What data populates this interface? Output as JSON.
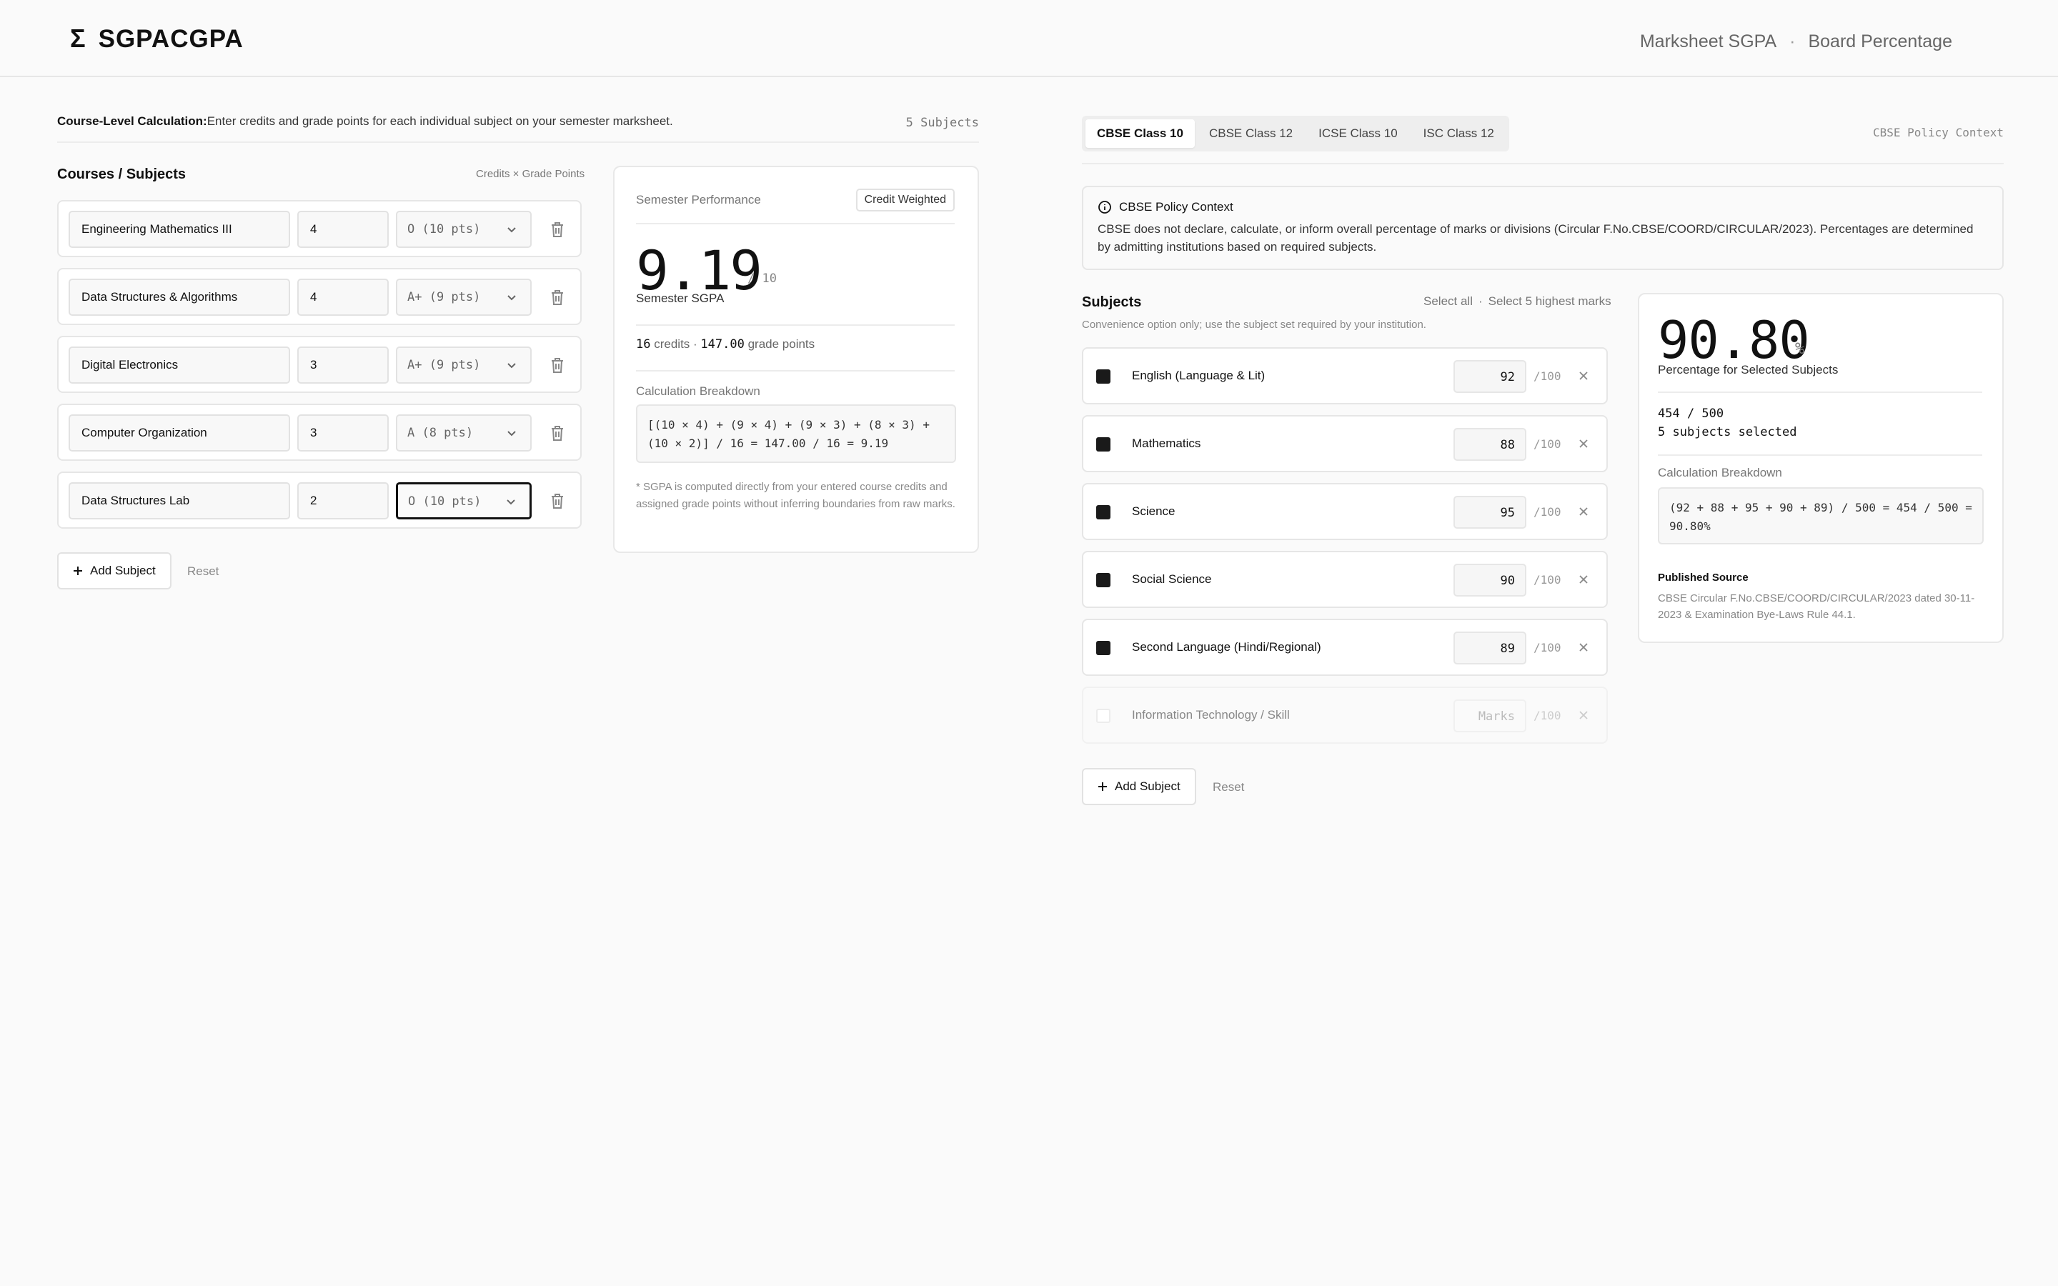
{
  "header": {
    "brand_symbol": "Σ",
    "brand_name": "SGPACGPA",
    "nav": [
      "Marksheet SGPA",
      "Board Percentage"
    ],
    "nav_separator": "·"
  },
  "left": {
    "intro_bold": "Course-Level Calculation:",
    "intro_text": "Enter credits and grade points for each individual subject on your semester marksheet.",
    "subject_count": "5 Subjects",
    "courses_title": "Courses / Subjects",
    "courses_hint": "Credits × Grade Points",
    "courses": [
      {
        "name": "Engineering Mathematics III",
        "credits": "4",
        "grade": "O (10 pts)"
      },
      {
        "name": "Data Structures & Algorithms",
        "credits": "4",
        "grade": "A+ (9 pts)"
      },
      {
        "name": "Digital Electronics",
        "credits": "3",
        "grade": "A+ (9 pts)"
      },
      {
        "name": "Computer Organization",
        "credits": "3",
        "grade": "A (8 pts)"
      },
      {
        "name": "Data Structures Lab",
        "credits": "2",
        "grade": "O (10 pts)"
      }
    ],
    "add_label": "Add Subject",
    "reset_label": "Reset"
  },
  "performance": {
    "label": "Semester Performance",
    "badge": "Credit Weighted",
    "sgpa": "9.19",
    "out_of": "/ 10",
    "sub": "Semester SGPA",
    "credits_value": "16",
    "credits_label": "credits ·",
    "points_value": "147.00",
    "points_label": "grade points",
    "breakdown_label": "Calculation Breakdown",
    "breakdown": "[(10 × 4) + (9 × 4) + (9 × 3) + (8 × 3) + (10 × 2)] / 16 = 147.00 / 16 = 9.19",
    "note": "* SGPA is computed directly from your entered course credits and assigned grade points without inferring boundaries from raw marks."
  },
  "right": {
    "tabs": [
      "CBSE Class 10",
      "CBSE Class 12",
      "ICSE Class 10",
      "ISC Class 12"
    ],
    "policy_link": "CBSE Policy Context",
    "policy_title": "CBSE Policy Context",
    "policy_body": "CBSE does not declare, calculate, or inform overall percentage of marks or divisions (Circular F.No.CBSE/COORD/CIRCULAR/2023). Percentages are determined by admitting institutions based on required subjects.",
    "subjects_title": "Subjects",
    "select_all": "Select all",
    "action_sep": "·",
    "select_top": "Select 5 highest marks",
    "subjects_note": "Convenience option only; use the subject set required by your institution.",
    "subjects": [
      {
        "name": "English (Language & Lit)",
        "marks": "92",
        "out_of": "/100"
      },
      {
        "name": "Mathematics",
        "marks": "88",
        "out_of": "/100"
      },
      {
        "name": "Science",
        "marks": "95",
        "out_of": "/100"
      },
      {
        "name": "Social Science",
        "marks": "90",
        "out_of": "/100"
      },
      {
        "name": "Second Language (Hindi/Regional)",
        "marks": "89",
        "out_of": "/100"
      },
      {
        "name": "Information Technology / Skill",
        "marks_placeholder": "Marks",
        "out_of": "/100"
      }
    ],
    "add_label": "Add Subject",
    "reset_label": "Reset"
  },
  "percentage": {
    "value": "90.80",
    "symbol": "%",
    "sub": "Percentage for Selected Subjects",
    "total": "454 / 500",
    "selected": "5 subjects selected",
    "breakdown_label": "Calculation Breakdown",
    "breakdown": "(92 + 88 + 95 + 90 + 89) / 500 = 454 / 500 = 90.80%",
    "source_label": "Published Source",
    "source": "CBSE Circular F.No.CBSE/COORD/CIRCULAR/2023 dated 30-11-2023 & Examination Bye-Laws Rule 44.1."
  }
}
